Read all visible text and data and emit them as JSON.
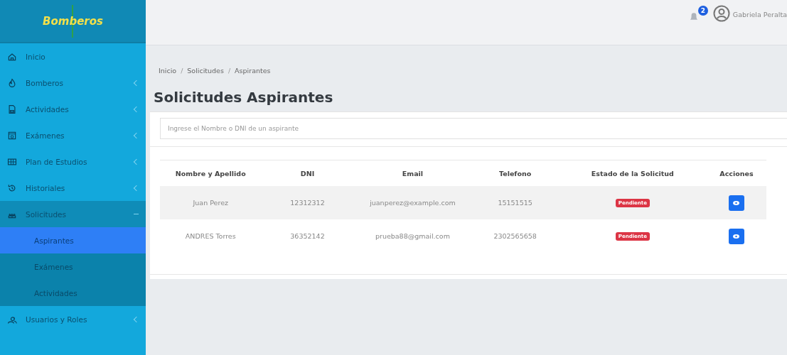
{
  "sidebar": {
    "logo": "Bomberos",
    "items": [
      {
        "label": "Inicio",
        "submenu": false,
        "expanded": false
      },
      {
        "label": "Bomberos",
        "submenu": true,
        "expanded": false
      },
      {
        "label": "Actividades",
        "submenu": true,
        "expanded": false
      },
      {
        "label": "Exámenes",
        "submenu": true,
        "expanded": false
      },
      {
        "label": "Plan de Estudios",
        "submenu": true,
        "expanded": false
      },
      {
        "label": "Historiales",
        "submenu": true,
        "expanded": false
      },
      {
        "label": "Solicitudes",
        "submenu": true,
        "expanded": true,
        "children": [
          {
            "label": "Aspirantes",
            "selected": true
          },
          {
            "label": "Exámenes",
            "selected": false
          },
          {
            "label": "Actividades",
            "selected": false
          }
        ]
      },
      {
        "label": "Usuarios y Roles",
        "submenu": true,
        "expanded": false
      }
    ]
  },
  "topbar": {
    "notifications": "2",
    "user": "Gabriela Peralta"
  },
  "breadcrumb": {
    "separator": "/",
    "items": [
      "Inicio",
      "Solicitudes",
      "Aspirantes"
    ]
  },
  "title": "Solicitudes Aspirantes",
  "search": {
    "placeholder": "Ingrese el Nombre o DNI de un aspirante"
  },
  "table": {
    "columns": [
      "Nombre y Apellido",
      "DNI",
      "Email",
      "Telefono",
      "Estado de la Solicitud",
      "Acciones"
    ],
    "rows": [
      {
        "name": "Juan Perez",
        "dni": "12312312",
        "email": "juanperez@example.com",
        "phone": "15151515",
        "status": "Pendiente",
        "color": "#dc3545"
      },
      {
        "name": "ANDRES Torres",
        "dni": "36352142",
        "email": "prueba88@gmail.com",
        "phone": "2302565658",
        "status": "Pendiente",
        "color": "#dc3545"
      }
    ]
  }
}
